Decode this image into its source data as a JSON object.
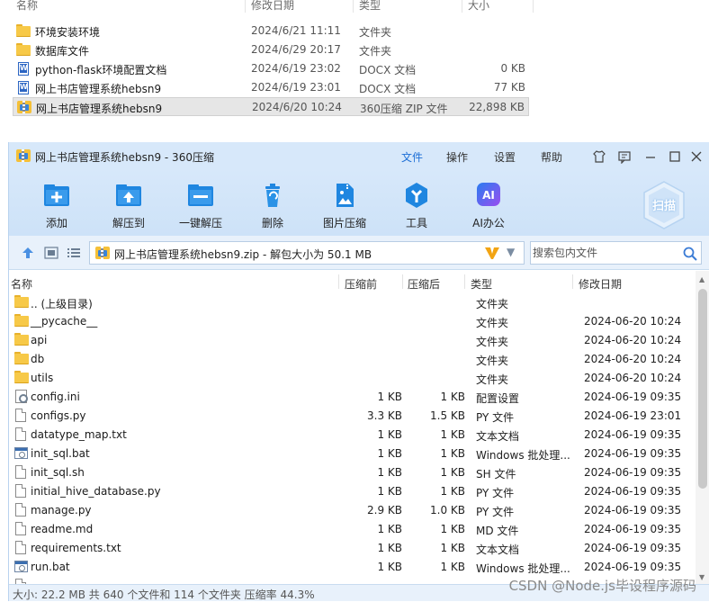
{
  "explorer": {
    "columns": [
      "名称",
      "修改日期",
      "类型",
      "大小"
    ],
    "rows": [
      {
        "icon": "folder-icon",
        "name": "环境安装环境",
        "date": "2024/6/21 11:11",
        "type": "文件夹",
        "size": ""
      },
      {
        "icon": "folder-icon",
        "name": "数据库文件",
        "date": "2024/6/29 20:17",
        "type": "文件夹",
        "size": ""
      },
      {
        "icon": "docx-icon",
        "name": "python-flask环境配置文档",
        "date": "2024/6/19 23:02",
        "type": "DOCX 文档",
        "size": "0 KB"
      },
      {
        "icon": "docx-icon",
        "name": "网上书店管理系统hebsn9",
        "date": "2024/6/19 23:01",
        "type": "DOCX 文档",
        "size": "77 KB"
      },
      {
        "icon": "zip-icon",
        "name": "网上书店管理系统hebsn9",
        "date": "2024/6/20 10:24",
        "type": "360压缩 ZIP 文件",
        "size": "22,898 KB",
        "selected": true
      }
    ]
  },
  "window": {
    "title": "网上书店管理系统hebsn9 - 360压缩",
    "menus": [
      "文件",
      "操作",
      "设置",
      "帮助"
    ],
    "active_menu": "文件",
    "title_buttons": [
      "skin-icon",
      "feedback-icon",
      "minimize-icon",
      "maximize-icon",
      "close-icon"
    ]
  },
  "toolbar": {
    "buttons": [
      {
        "icon": "add-icon",
        "label": "添加"
      },
      {
        "icon": "extract-to-icon",
        "label": "解压到"
      },
      {
        "icon": "one-click-extract-icon",
        "label": "一键解压"
      },
      {
        "icon": "delete-icon",
        "label": "删除"
      },
      {
        "icon": "image-compress-icon",
        "label": "图片压缩"
      },
      {
        "icon": "tools-icon",
        "label": "工具"
      },
      {
        "icon": "ai-office-icon",
        "label": "AI办公"
      }
    ],
    "scan_label": "扫描"
  },
  "address": {
    "path": "网上书店管理系统hebsn9.zip - 解包大小为 50.1 MB",
    "search_placeholder": "搜索包内文件"
  },
  "list": {
    "columns": {
      "name": "名称",
      "compressed": "压缩前",
      "uncompressed": "压缩后",
      "type": "类型",
      "date": "修改日期"
    },
    "rows": [
      {
        "icon": "folder-icon",
        "name": ".. (上级目录)",
        "compressed": "",
        "uncompressed": "",
        "type": "文件夹",
        "date": ""
      },
      {
        "icon": "folder-icon",
        "name": "__pycache__",
        "compressed": "",
        "uncompressed": "",
        "type": "文件夹",
        "date": "2024-06-20 10:24"
      },
      {
        "icon": "folder-icon",
        "name": "api",
        "compressed": "",
        "uncompressed": "",
        "type": "文件夹",
        "date": "2024-06-20 10:24"
      },
      {
        "icon": "folder-icon",
        "name": "db",
        "compressed": "",
        "uncompressed": "",
        "type": "文件夹",
        "date": "2024-06-20 10:24"
      },
      {
        "icon": "folder-icon",
        "name": "utils",
        "compressed": "",
        "uncompressed": "",
        "type": "文件夹",
        "date": "2024-06-20 10:24"
      },
      {
        "icon": "config-file-icon",
        "name": "config.ini",
        "compressed": "1 KB",
        "uncompressed": "1 KB",
        "type": "配置设置",
        "date": "2024-06-19 09:35"
      },
      {
        "icon": "file-icon",
        "name": "configs.py",
        "compressed": "3.3 KB",
        "uncompressed": "1.5 KB",
        "type": "PY 文件",
        "date": "2024-06-19 23:01"
      },
      {
        "icon": "file-icon",
        "name": "datatype_map.txt",
        "compressed": "1 KB",
        "uncompressed": "1 KB",
        "type": "文本文档",
        "date": "2024-06-19 09:35"
      },
      {
        "icon": "bat-file-icon",
        "name": "init_sql.bat",
        "compressed": "1 KB",
        "uncompressed": "1 KB",
        "type": "Windows 批处理...",
        "date": "2024-06-19 09:35"
      },
      {
        "icon": "file-icon",
        "name": "init_sql.sh",
        "compressed": "1 KB",
        "uncompressed": "1 KB",
        "type": "SH 文件",
        "date": "2024-06-19 09:35"
      },
      {
        "icon": "file-icon",
        "name": "initial_hive_database.py",
        "compressed": "1 KB",
        "uncompressed": "1 KB",
        "type": "PY 文件",
        "date": "2024-06-19 09:35"
      },
      {
        "icon": "file-icon",
        "name": "manage.py",
        "compressed": "2.9 KB",
        "uncompressed": "1.0 KB",
        "type": "PY 文件",
        "date": "2024-06-19 09:35"
      },
      {
        "icon": "file-icon",
        "name": "readme.md",
        "compressed": "1 KB",
        "uncompressed": "1 KB",
        "type": "MD 文件",
        "date": "2024-06-19 09:35"
      },
      {
        "icon": "file-icon",
        "name": "requirements.txt",
        "compressed": "1 KB",
        "uncompressed": "1 KB",
        "type": "文本文档",
        "date": "2024-06-19 09:35"
      },
      {
        "icon": "bat-file-icon",
        "name": "run.bat",
        "compressed": "1 KB",
        "uncompressed": "1 KB",
        "type": "Windows 批处理...",
        "date": "2024-06-19 09:35"
      },
      {
        "icon": "file-icon",
        "name": "",
        "compressed": "",
        "uncompressed": "",
        "type": "",
        "date": ""
      }
    ]
  },
  "status": {
    "text": "大小: 22.2 MB 共 640 个文件和 114 个文件夹 压缩率 44.3%"
  },
  "watermark": "CSDN @Node.js毕设程序源码"
}
